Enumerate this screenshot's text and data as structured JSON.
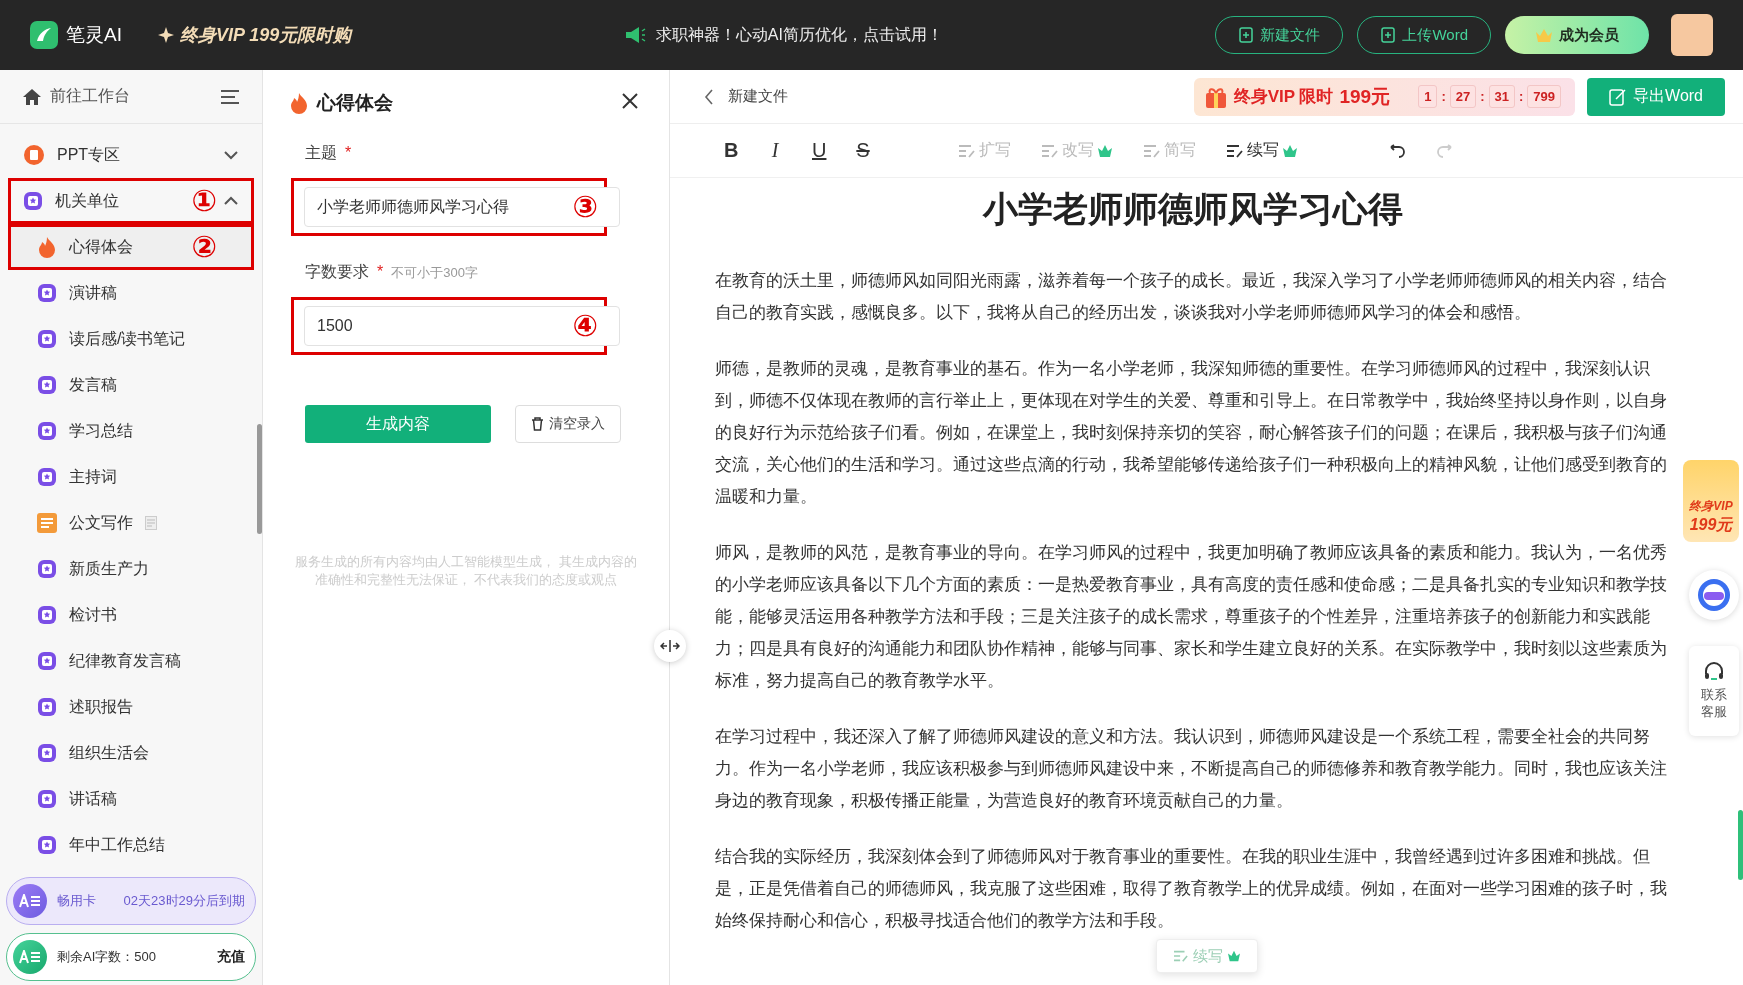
{
  "top_bar": {
    "logo": "笔灵AI",
    "promo": "终身VIP 199元限时购",
    "notice": "求职神器！心动AI简历优化，点击试用！",
    "buttons": [
      {
        "label": "新建文件",
        "kind": "outline"
      },
      {
        "label": "上传Word",
        "kind": "outline"
      },
      {
        "label": "成为会员",
        "kind": "member"
      }
    ]
  },
  "sidebar": {
    "home": "前往工作台",
    "sections": [
      {
        "label": "PPT专区",
        "kind": "ppt",
        "expanded": false
      },
      {
        "label": "机关单位",
        "kind": "star",
        "expanded": true,
        "callout": "①",
        "children": [
          {
            "label": "心得体会",
            "kind": "fire",
            "callout": "②",
            "selected": true
          },
          {
            "label": "演讲稿",
            "kind": "star",
            "selected": false
          },
          {
            "label": "读后感/读书笔记",
            "kind": "star",
            "selected": false
          },
          {
            "label": "发言稿",
            "kind": "star",
            "selected": false
          },
          {
            "label": "学习总结",
            "kind": "star",
            "selected": false
          },
          {
            "label": "主持词",
            "kind": "star",
            "selected": false
          },
          {
            "label": "公文写作",
            "kind": "doc",
            "selected": false
          },
          {
            "label": "新质生产力",
            "kind": "star",
            "selected": false
          },
          {
            "label": "检讨书",
            "kind": "star",
            "selected": false
          },
          {
            "label": "纪律教育发言稿",
            "kind": "star",
            "selected": false
          },
          {
            "label": "述职报告",
            "kind": "star",
            "selected": false
          },
          {
            "label": "组织生活会",
            "kind": "star",
            "selected": false
          },
          {
            "label": "讲话稿",
            "kind": "star",
            "selected": false
          },
          {
            "label": "年中工作总结",
            "kind": "star",
            "selected": false
          }
        ]
      }
    ],
    "card": {
      "name": "畅用卡",
      "expiry": "02天23时29分后到期"
    },
    "quota": {
      "label": "剩余AI字数：500",
      "action": "充值"
    }
  },
  "form": {
    "title": "心得体会",
    "fields": [
      {
        "label": "主题",
        "required_mark": "*",
        "value": "小学老师师德师风学习心得",
        "callout": "③"
      },
      {
        "label": "字数要求",
        "required_mark": "*",
        "hint": "不可小于300字",
        "value": "1500",
        "callout": "④"
      }
    ],
    "generate": "生成内容",
    "clear": "清空录入",
    "disclaimer": "服务生成的所有内容均由人工智能模型生成， 其生成内容的准确性和完整性无法保证， 不代表我们的态度或观点"
  },
  "editor": {
    "file": "新建文件",
    "vip": {
      "label": "终身VIP 限时",
      "price": "199元",
      "countdown": [
        "1",
        "27",
        "31",
        "799"
      ],
      "separators": [
        ":",
        ":",
        ":"
      ]
    },
    "export": "导出Word",
    "format": [
      {
        "kind": "bold",
        "label": "B"
      },
      {
        "kind": "italic",
        "label": "I"
      },
      {
        "kind": "underline",
        "label": "U"
      },
      {
        "kind": "strike",
        "label": "S"
      }
    ],
    "tools": [
      {
        "label": "扩写",
        "disabled": true,
        "premium": false
      },
      {
        "label": "改写",
        "disabled": true,
        "premium": true
      },
      {
        "label": "简写",
        "disabled": true,
        "premium": false
      },
      {
        "label": "续写",
        "disabled": false,
        "premium": true
      }
    ],
    "redo_disabled": true,
    "title": "小学老师师德师风学习心得",
    "paragraphs": [
      "在教育的沃土里，师德师风如同阳光雨露，滋养着每一个孩子的成长。最近，我深入学习了小学老师师德师风的相关内容，结合自己的教育实践，感慨良多。以下，我将从自己的经历出发，谈谈我对小学老师师德师风学习的体会和感悟。",
      "师德，是教师的灵魂，是教育事业的基石。作为一名小学老师，我深知师德的重要性。在学习师德师风的过程中，我深刻认识到，师德不仅体现在教师的言行举止上，更体现在对学生的关爱、尊重和引导上。在日常教学中，我始终坚持以身作则，以自身的良好行为示范给孩子们看。例如，在课堂上，我时刻保持亲切的笑容，耐心解答孩子们的问题；在课后，我积极与孩子们沟通交流，关心他们的生活和学习。通过这些点滴的行动，我希望能够传递给孩子们一种积极向上的精神风貌，让他们感受到教育的温暖和力量。",
      "师风，是教师的风范，是教育事业的导向。在学习师风的过程中，我更加明确了教师应该具备的素质和能力。我认为，一名优秀的小学老师应该具备以下几个方面的素质：一是热爱教育事业，具有高度的责任感和使命感；二是具备扎实的专业知识和教学技能，能够灵活运用各种教学方法和手段；三是关注孩子的成长需求，尊重孩子的个性差异，注重培养孩子的创新能力和实践能力；四是具有良好的沟通能力和团队协作精神，能够与同事、家长和学生建立良好的关系。在实际教学中，我时刻以这些素质为标准，努力提高自己的教育教学水平。",
      "在学习过程中，我还深入了解了师德师风建设的意义和方法。我认识到，师德师风建设是一个系统工程，需要全社会的共同努力。作为一名小学老师，我应该积极参与到师德师风建设中来，不断提高自己的师德修养和教育教学能力。同时，我也应该关注身边的教育现象，积极传播正能量，为营造良好的教育环境贡献自己的力量。",
      "结合我的实际经历，我深刻体会到了师德师风对于教育事业的重要性。在我的职业生涯中，我曾经遇到过许多困难和挑战。但是，正是凭借着自己的师德师风，我克服了这些困难，取得了教育教学上的优异成绩。例如，在面对一些学习困难的孩子时，我始终保持耐心和信心，积极寻找适合他们的教学方法和手段。"
    ],
    "float_tool": "续写"
  },
  "side_widgets": {
    "gift": [
      "终身VIP",
      "199元"
    ],
    "support": "联系客服"
  }
}
